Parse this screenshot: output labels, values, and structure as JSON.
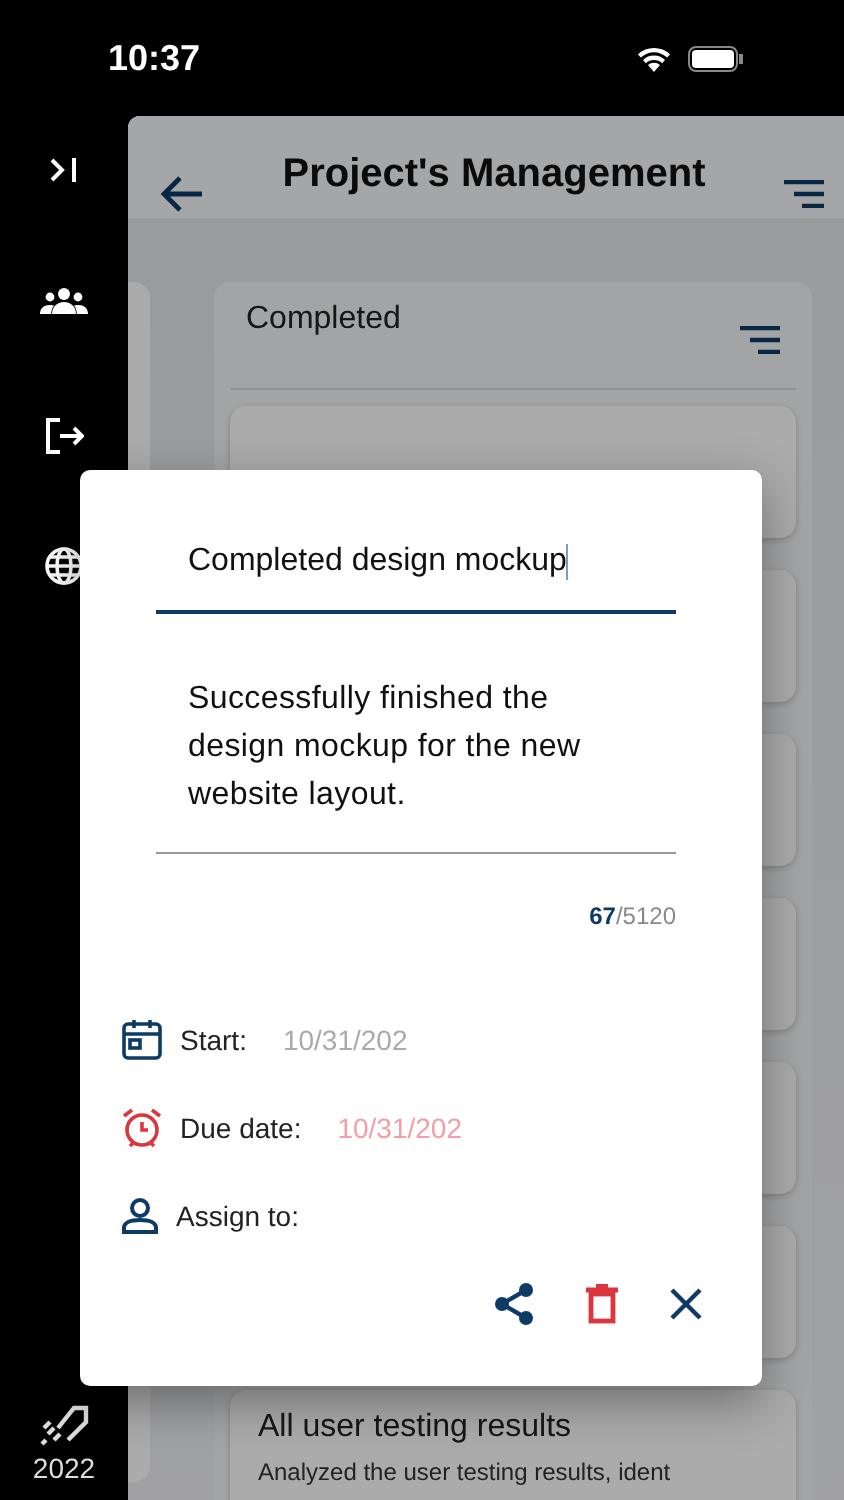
{
  "status_bar": {
    "time": "10:37"
  },
  "sidebar": {
    "items": [
      {
        "kind": "expand"
      },
      {
        "kind": "team"
      },
      {
        "kind": "logout"
      },
      {
        "kind": "language"
      }
    ],
    "year": "2022"
  },
  "header": {
    "title": "Project's Management"
  },
  "column": {
    "title": "Completed",
    "cards": [
      {
        "kind": "hidden"
      },
      {
        "kind": "hidden"
      },
      {
        "kind": "hidden"
      },
      {
        "kind": "hidden"
      },
      {
        "kind": "hidden"
      },
      {
        "kind": "hidden"
      },
      {
        "kind": "task",
        "title": "All user testing results",
        "description": "Analyzed the user testing results, ident"
      }
    ]
  },
  "dialog": {
    "title_value": "Completed design mockup",
    "title_focused": true,
    "description": "Successfully finished the design mockup for the new website layout.",
    "count": "67",
    "max": "/5120",
    "fields": [
      {
        "kind": "start",
        "label": "Start:",
        "value": "10/31/202",
        "overdue": false
      },
      {
        "kind": "due",
        "label": "Due date:",
        "value": "10/31/202",
        "overdue": true
      },
      {
        "kind": "assign",
        "label": "Assign to:"
      }
    ],
    "actions": [
      {
        "kind": "share"
      },
      {
        "kind": "delete"
      },
      {
        "kind": "close"
      }
    ]
  }
}
